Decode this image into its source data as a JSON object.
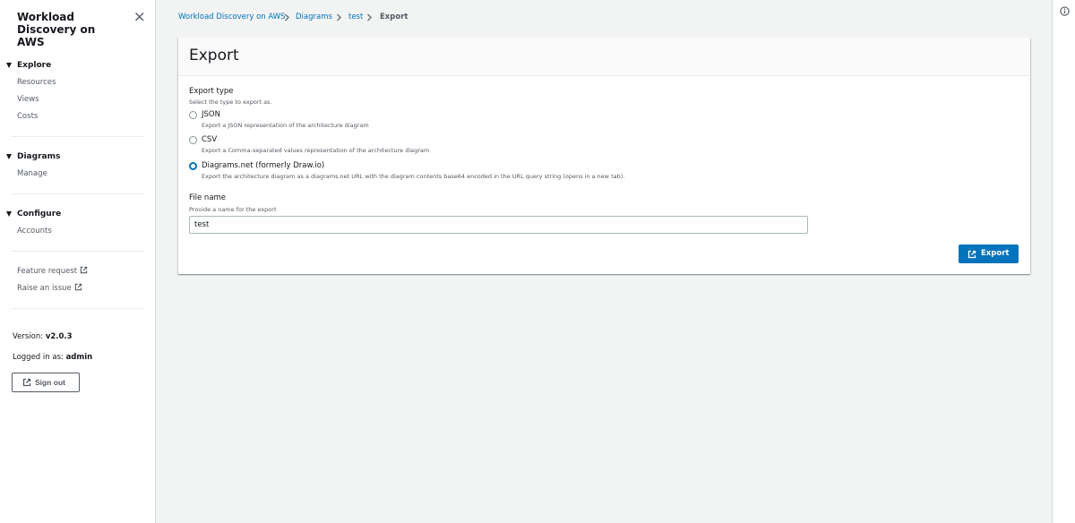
{
  "sidebar": {
    "title": "Workload Discovery on AWS",
    "sections": [
      {
        "label": "Explore",
        "items": [
          "Resources",
          "Views",
          "Costs"
        ]
      },
      {
        "label": "Diagrams",
        "items": [
          "Manage"
        ]
      },
      {
        "label": "Configure",
        "items": [
          "Accounts"
        ]
      }
    ],
    "links": [
      "Feature request",
      "Raise an issue"
    ],
    "version_label": "Version:",
    "version_value": "v2.0.3",
    "logged_label": "Logged in as:",
    "logged_value": "admin",
    "signout_label": "Sign out"
  },
  "breadcrumb": {
    "items": [
      "Workload Discovery on AWS",
      "Diagrams",
      "test"
    ],
    "current": "Export"
  },
  "panel": {
    "title": "Export",
    "export_type_label": "Export type",
    "export_type_desc": "Select the type to export as.",
    "options": [
      {
        "label": "JSON",
        "desc": "Export a JSON representation of the architecture diagram",
        "selected": false
      },
      {
        "label": "CSV",
        "desc": "Export a Comma-separated values representation of the architecture diagram",
        "selected": false
      },
      {
        "label": "Diagrams.net (formerly Draw.io)",
        "desc": "Export the architecture diagram as a diagrams.net URL with the diagram contents base64 encoded in the URL query string (opens in a new tab).",
        "selected": true
      }
    ],
    "file_name_label": "File name",
    "file_name_desc": "Provide a name for the export",
    "file_name_value": "test",
    "export_button": "Export"
  },
  "colors": {
    "accent": "#0073bb",
    "background": "#f2f3f3",
    "text": "#16191f",
    "muted": "#545b64"
  }
}
